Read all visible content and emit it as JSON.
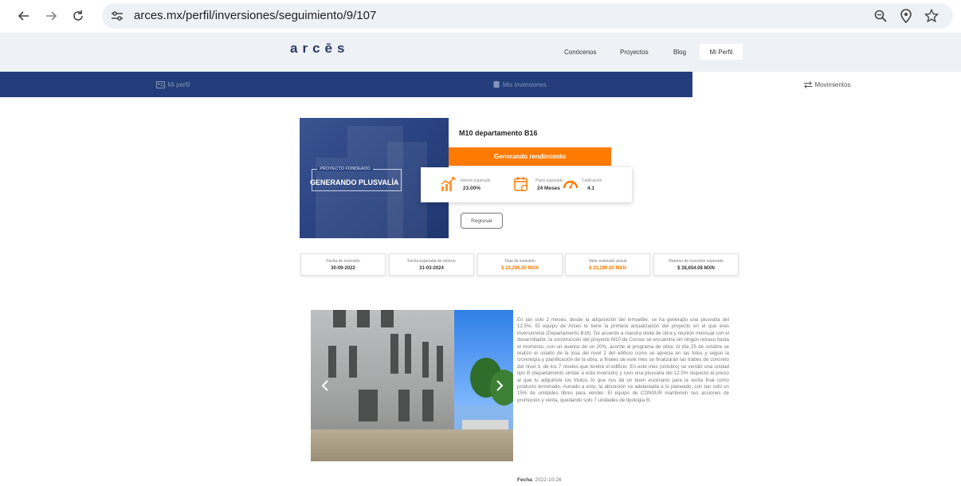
{
  "browser": {
    "url": "arces.mx/perfil/inversiones/seguimiento/9/107"
  },
  "site": {
    "logo": "arcēs",
    "nav": [
      "Conócenos",
      "Proyectos",
      "Blog"
    ],
    "profile_button": "Mi Perfil"
  },
  "tabs": [
    "Mi perfil",
    "Mis inversiones",
    "Movimientos"
  ],
  "project": {
    "hero_label_1": "PROYECTO FONDEADO",
    "hero_label_2": "GENERANDO PLUSVALÍA",
    "title": "M10 departamento B16",
    "status": "Generando rendimiento",
    "metrics": [
      {
        "label": "Interes esperado",
        "value": "23.00%",
        "icon": "growth-chart-icon"
      },
      {
        "label": "Plazo esperado",
        "value": "24 Meses",
        "icon": "calendar-icon"
      },
      {
        "label": "Calificación",
        "value": "4.1",
        "icon": "gauge-icon"
      }
    ],
    "back_button": "Regresar"
  },
  "info": [
    {
      "label": "Fecha de inversión",
      "value": "30-09-2022",
      "highlight": false
    },
    {
      "label": "Fecha esperada de retorno",
      "value": "31-03-2024",
      "highlight": false
    },
    {
      "label": "Total de inversión",
      "value": "$ 23,296.00 MXN",
      "highlight": true
    },
    {
      "label": "Valor estimado actual",
      "value": "$ 23,296.00 MXN",
      "highlight": true
    },
    {
      "label": "Retorno de inversión esperado",
      "value": "$ 28,654.08 MXN",
      "highlight": false
    }
  ],
  "update": {
    "text": "En tan solo 2 meses, desde la adquisición del inmueble, se ha generado una plusvalía del 12.5%. El equipo de Arces te tiene la primera actualización del proyecto en el que eres inversionista (Departamento B16). De acuerdo a nuestra visita de obra y reunión mensual con el desarrollador, la construcción del proyecto M10 de Consur se encuentra sin ningún retraso hasta el momento, con un avance de un 20%, acorde al programa de obra. Al día 25 de octubre se realizó el colado de la losa del nivel 2 del edificio como se aprecia en las fotos y según la cronología y planificación de la obra, a finales de este mes se finalizarán las trabes de concreto del nivel 3, de los 7 niveles que tendrá el edificio. En este mes (octubre) se vendió una unidad tipo B (departamento similar a esta inversión) y tuvo una plusvalía del 12.5% respecto al precio al que tu adquiriste tus títulos, lo que nos da un buen escenario para la venta final como producto terminado. Aunado a esto, la absorción va adelantada a lo planeado, con tan solo un 15% de unidades libres para vender. El equipo de CONSUR mantienen sus acciones de promoción y venta, quedando solo 7 unidades de tipología B.",
    "date_label": "Fecha",
    "date_value": "2022-10-26"
  },
  "colors": {
    "navy": "#223d7a",
    "orange": "#ff7a00"
  }
}
